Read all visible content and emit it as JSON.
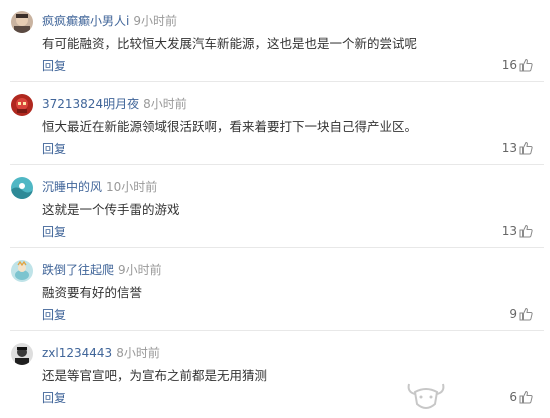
{
  "comments": [
    {
      "username": "疯疯癫癫小男人i",
      "time": "9小时前",
      "content": "有可能融资，比较恒大发展汽车新能源，这也是也是一个新的尝试呢",
      "reply_label": "回复",
      "likes": "16",
      "avatar_icon": "face-avatar-icon"
    },
    {
      "username": "37213824明月夜",
      "time": "8小时前",
      "content": "恒大最近在新能源领域很活跃啊，看来着要打下一块自己得产业区。",
      "reply_label": "回复",
      "likes": "13",
      "avatar_icon": "robot-avatar-icon"
    },
    {
      "username": "沉睡中的风",
      "time": "10小时前",
      "content": "这就是一个传手雷的游戏",
      "reply_label": "回复",
      "likes": "13",
      "avatar_icon": "wave-avatar-icon"
    },
    {
      "username": "跌倒了往起爬",
      "time": "9小时前",
      "content": "融资要有好的信誉",
      "reply_label": "回复",
      "likes": "9",
      "avatar_icon": "cartoon-avatar-icon"
    },
    {
      "username": "zxl1234443",
      "time": "8小时前",
      "content": "还是等官宣吧，为宣布之前都是无用猜测",
      "reply_label": "回复",
      "likes": "6",
      "avatar_icon": "person-avatar-icon"
    }
  ],
  "colors": {
    "username": "#406599",
    "timestamp": "#999999",
    "content": "#333333",
    "divider": "#e8e8e8"
  }
}
